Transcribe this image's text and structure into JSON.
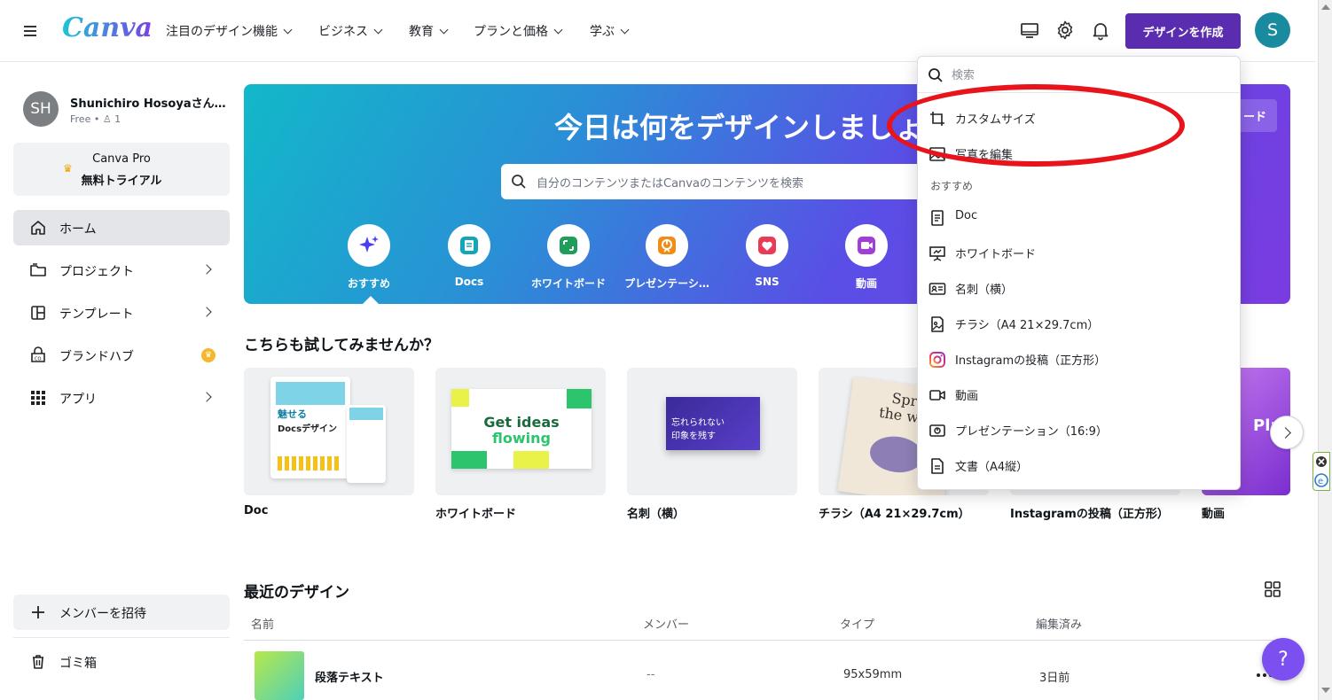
{
  "topbar": {
    "logo": "Canva",
    "nav": [
      {
        "label": "注目のデザイン機能"
      },
      {
        "label": "ビジネス"
      },
      {
        "label": "教育"
      },
      {
        "label": "プランと価格"
      },
      {
        "label": "学ぶ"
      }
    ],
    "create_label": "デザインを作成",
    "avatar_initial": "S"
  },
  "sidebar": {
    "user_initials": "SH",
    "user_name": "Shunichiro Hosoyaさん…",
    "user_plan": "Free • ♙ 1",
    "pro_line1": "Canva Pro",
    "pro_line2": "無料トライアル",
    "items": [
      {
        "label": "ホーム",
        "icon": "home-icon"
      },
      {
        "label": "プロジェクト",
        "icon": "folder-icon"
      },
      {
        "label": "テンプレート",
        "icon": "template-icon"
      },
      {
        "label": "ブランドハブ",
        "icon": "brand-icon"
      },
      {
        "label": "アプリ",
        "icon": "apps-icon"
      }
    ],
    "invite_label": "メンバーを招待",
    "trash_label": "ゴミ箱"
  },
  "hero": {
    "title": "今日は何をデザインしましょう",
    "search_placeholder": "自分のコンテンツまたはCanvaのコンテンツを検索",
    "upload_label": "ード",
    "categories": [
      {
        "label": "おすすめ",
        "icon": "sparkle-icon"
      },
      {
        "label": "Docs",
        "icon": "docs-icon"
      },
      {
        "label": "ホワイトボード",
        "icon": "whiteboard-icon"
      },
      {
        "label": "プレゼンテーシ…",
        "icon": "presentation-icon"
      },
      {
        "label": "SNS",
        "icon": "heart-icon"
      },
      {
        "label": "動画",
        "icon": "video-icon"
      }
    ]
  },
  "try_section": {
    "title": "こちらも試してみませんか？",
    "cards": [
      {
        "label": "Doc",
        "thumb_line1": "魅せる",
        "thumb_line2": "Docsデザイン"
      },
      {
        "label": "ホワイトボード",
        "thumb_line1": "Get ideas",
        "thumb_line2": "flowing"
      },
      {
        "label": "名刺（横）",
        "thumb_line1": "忘れられない",
        "thumb_line2": "印象を残す"
      },
      {
        "label": "チラシ（A4 21×29.7cm）",
        "thumb_line1": "Spre",
        "thumb_line2": "the wo"
      },
      {
        "label": "Instagramの投稿（正方形）"
      },
      {
        "label": "動画",
        "thumb_line1": "Pla"
      }
    ]
  },
  "recent": {
    "title": "最近のデザイン",
    "columns": [
      "名前",
      "メンバー",
      "タイプ",
      "編集済み"
    ],
    "rows": [
      {
        "name": "段落テキスト",
        "members": "--",
        "type": "95x59mm",
        "edited": "3日前"
      }
    ]
  },
  "help_label": "?",
  "dropdown": {
    "search_placeholder": "検索",
    "top_items": [
      {
        "label": "カスタムサイズ",
        "icon": "custom-size-icon"
      },
      {
        "label": "写真を編集",
        "icon": "photo-edit-icon"
      }
    ],
    "section_label": "おすすめ",
    "items": [
      {
        "label": "Doc",
        "icon": "doc-icon"
      },
      {
        "label": "ホワイトボード",
        "icon": "whiteboard-icon"
      },
      {
        "label": "名刺（横）",
        "icon": "business-card-icon"
      },
      {
        "label": "チラシ（A4 21×29.7cm）",
        "icon": "flyer-icon"
      },
      {
        "label": "Instagramの投稿（正方形）",
        "icon": "instagram-icon"
      },
      {
        "label": "動画",
        "icon": "video-icon"
      },
      {
        "label": "プレゼンテーション（16:9）",
        "icon": "presentation-icon"
      },
      {
        "label": "文書（A4縦）",
        "icon": "document-icon"
      }
    ]
  },
  "colors": {
    "accent": "#5a2db0",
    "annotation": "#e8141c",
    "help": "#7b4ff0"
  }
}
